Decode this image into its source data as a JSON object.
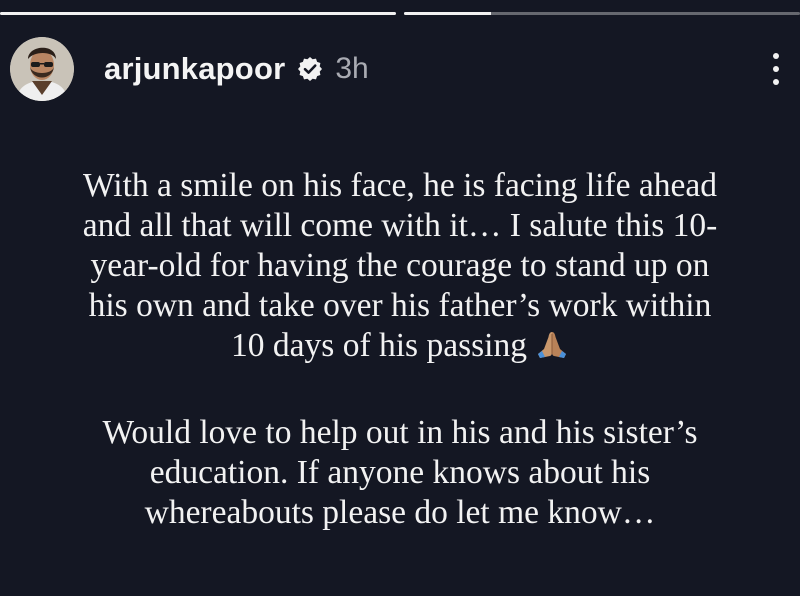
{
  "story": {
    "progress": [
      {
        "fill": 100
      },
      {
        "fill": 22
      }
    ],
    "header": {
      "username": "arjunkapoor",
      "time": "3h",
      "icons": {
        "avatar": "profile-avatar",
        "verified": "verified-badge-icon",
        "more": "more-options-icon"
      }
    },
    "text": {
      "paragraph1": [
        "With a smile on his face, he is facing life ahead",
        "and all that will come with it… I salute this 10-",
        "year-old for having the courage to stand up on",
        "his own and take over his father’s work within",
        "10 days of his passing"
      ],
      "paragraph1_emoji": "folded-hands-icon",
      "paragraph2": [
        "Would love to help out in his and his sister’s",
        "education. If anyone knows about his",
        "whereabouts please do let me know…"
      ]
    },
    "colors": {
      "background": "#141723",
      "text": "#f2f2f2",
      "muted": "#a9abb2"
    }
  }
}
